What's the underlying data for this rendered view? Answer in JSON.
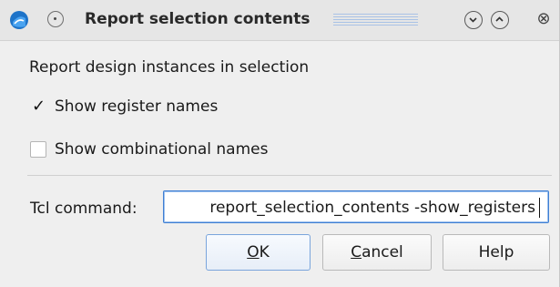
{
  "window": {
    "title": "Report selection contents",
    "colors": {
      "accent": "#3f7fd3",
      "titlebar": "#e6e6e6",
      "background": "#efefef"
    }
  },
  "titlebar": {
    "app_icon": "app-logo-icon",
    "menu_icon": "window-menu-icon",
    "minimize_icon": "chevron-down-icon",
    "maximize_icon": "chevron-up-icon",
    "close_icon": "close-icon",
    "close_glyph": "⊗"
  },
  "body": {
    "description": "Report design instances in selection",
    "options": [
      {
        "label": "Show register names",
        "checked": true
      },
      {
        "label": "Show combinational names",
        "checked": false
      }
    ],
    "tcl": {
      "label": "Tcl command:",
      "value": "report_selection_contents -show_registers"
    }
  },
  "buttons": {
    "ok": {
      "mnemonic": "O",
      "rest": "K"
    },
    "cancel": {
      "mnemonic": "C",
      "rest": "ancel"
    },
    "help": {
      "label": "Help"
    }
  }
}
